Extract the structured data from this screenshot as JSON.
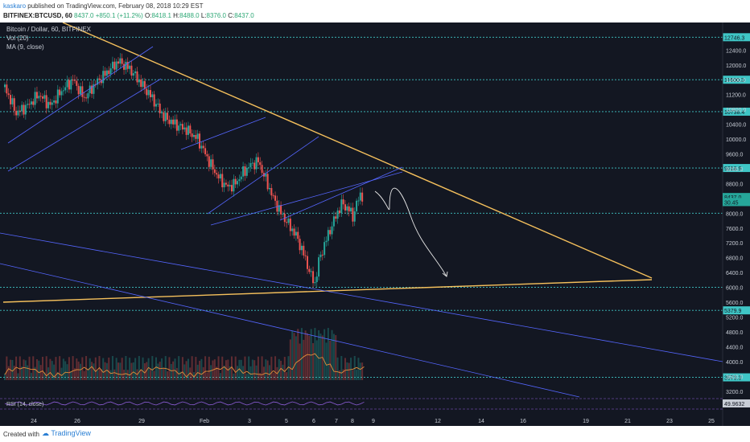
{
  "header": {
    "author": "kaskaro",
    "published": "published on TradingView.com, February 08, 2018 10:29 EST",
    "symbol": "BITFINEX:BTCUSD, 60",
    "last": "8437.0",
    "change": "+850.1 (+11.2%)",
    "o_label": "O:",
    "o_value": "8418.1",
    "h_label": "H:",
    "h_value": "8488.0",
    "l_label": "L:",
    "l_value": "8376.0",
    "c_label": "C:",
    "c_value": "8437.0"
  },
  "legend": {
    "title": "Bitcoin / Dollar, 60, BITFINEX",
    "vol": "Vol (20)",
    "ma": "MA (9, close)",
    "rsi": "RSI (14, close)"
  },
  "footer": {
    "created_with": "Created with",
    "brand": "TradingView"
  },
  "chart_data": {
    "type": "candlestick",
    "title": "Bitcoin / Dollar, 60, BITFINEX",
    "ylim": [
      3000,
      13100
    ],
    "y_ticks": [
      3200,
      3600,
      4000,
      4400,
      4800,
      5200,
      5600,
      6000,
      6400,
      6800,
      7200,
      7600,
      8000,
      8400,
      8800,
      9200,
      9600,
      10000,
      10400,
      10800,
      11200,
      11600,
      12000,
      12400
    ],
    "x_ticks": [
      "24",
      "26",
      "29",
      "Feb",
      "3",
      "5",
      "6",
      "7",
      "8",
      "9",
      "12",
      "14",
      "16",
      "19",
      "21",
      "23",
      "25"
    ],
    "horizontal_levels": [
      {
        "value": 12746.3,
        "label": "12746.3"
      },
      {
        "value": 11600.3,
        "label": "11600.3"
      },
      {
        "value": 10738.4,
        "label": "10738.4"
      },
      {
        "value": 9218.9,
        "label": "9218.9"
      },
      {
        "value": 8000,
        "label": ""
      },
      {
        "value": 6000,
        "label": ""
      },
      {
        "value": 5379.9,
        "label": "5379.9"
      },
      {
        "value": 3573.3,
        "label": "3573.3"
      }
    ],
    "last_price": {
      "value": 8437.0,
      "label": "8437.0"
    },
    "ma_value": {
      "value": 8300,
      "label": "30.45"
    },
    "rsi_value": "49.9632",
    "price_path": [
      {
        "x": 0,
        "p": 11400
      },
      {
        "x": 3,
        "p": 10700
      },
      {
        "x": 6,
        "p": 10900
      },
      {
        "x": 9,
        "p": 11200
      },
      {
        "x": 12,
        "p": 10900
      },
      {
        "x": 15,
        "p": 11300
      },
      {
        "x": 18,
        "p": 11600
      },
      {
        "x": 21,
        "p": 11100
      },
      {
        "x": 24,
        "p": 11500
      },
      {
        "x": 27,
        "p": 11800
      },
      {
        "x": 30,
        "p": 12100
      },
      {
        "x": 33,
        "p": 11900
      },
      {
        "x": 36,
        "p": 11500
      },
      {
        "x": 39,
        "p": 11100
      },
      {
        "x": 42,
        "p": 10600
      },
      {
        "x": 45,
        "p": 10400
      },
      {
        "x": 48,
        "p": 10250
      },
      {
        "x": 51,
        "p": 10000
      },
      {
        "x": 53,
        "p": 9600
      },
      {
        "x": 55,
        "p": 9200
      },
      {
        "x": 57,
        "p": 8900
      },
      {
        "x": 59,
        "p": 8700
      },
      {
        "x": 61,
        "p": 8800
      },
      {
        "x": 63,
        "p": 9100
      },
      {
        "x": 65,
        "p": 9300
      },
      {
        "x": 67,
        "p": 9400
      },
      {
        "x": 69,
        "p": 8900
      },
      {
        "x": 71,
        "p": 8400
      },
      {
        "x": 73,
        "p": 8000
      },
      {
        "x": 75,
        "p": 7700
      },
      {
        "x": 77,
        "p": 7400
      },
      {
        "x": 79,
        "p": 6900
      },
      {
        "x": 81,
        "p": 6300
      },
      {
        "x": 82,
        "p": 6100
      },
      {
        "x": 83,
        "p": 6700
      },
      {
        "x": 85,
        "p": 7300
      },
      {
        "x": 87,
        "p": 7800
      },
      {
        "x": 89,
        "p": 8250
      },
      {
        "x": 91,
        "p": 8100
      },
      {
        "x": 92,
        "p": 7900
      },
      {
        "x": 93,
        "p": 8250
      },
      {
        "x": 94,
        "p": 8500
      },
      {
        "x": 95,
        "p": 8437
      }
    ],
    "series": [
      {
        "name": "Vol (20)",
        "type": "volume"
      },
      {
        "name": "MA (9, close)",
        "type": "line"
      },
      {
        "name": "RSI (14, close)",
        "type": "line"
      }
    ],
    "colors": {
      "background": "#131722",
      "up": "#26a69a",
      "down": "#ef5350",
      "trend": "#f5c05c",
      "channel": "#5566ff",
      "level": "#3fc6c6",
      "ma": "#e28e3a",
      "rsi": "#8c5cd6"
    }
  }
}
